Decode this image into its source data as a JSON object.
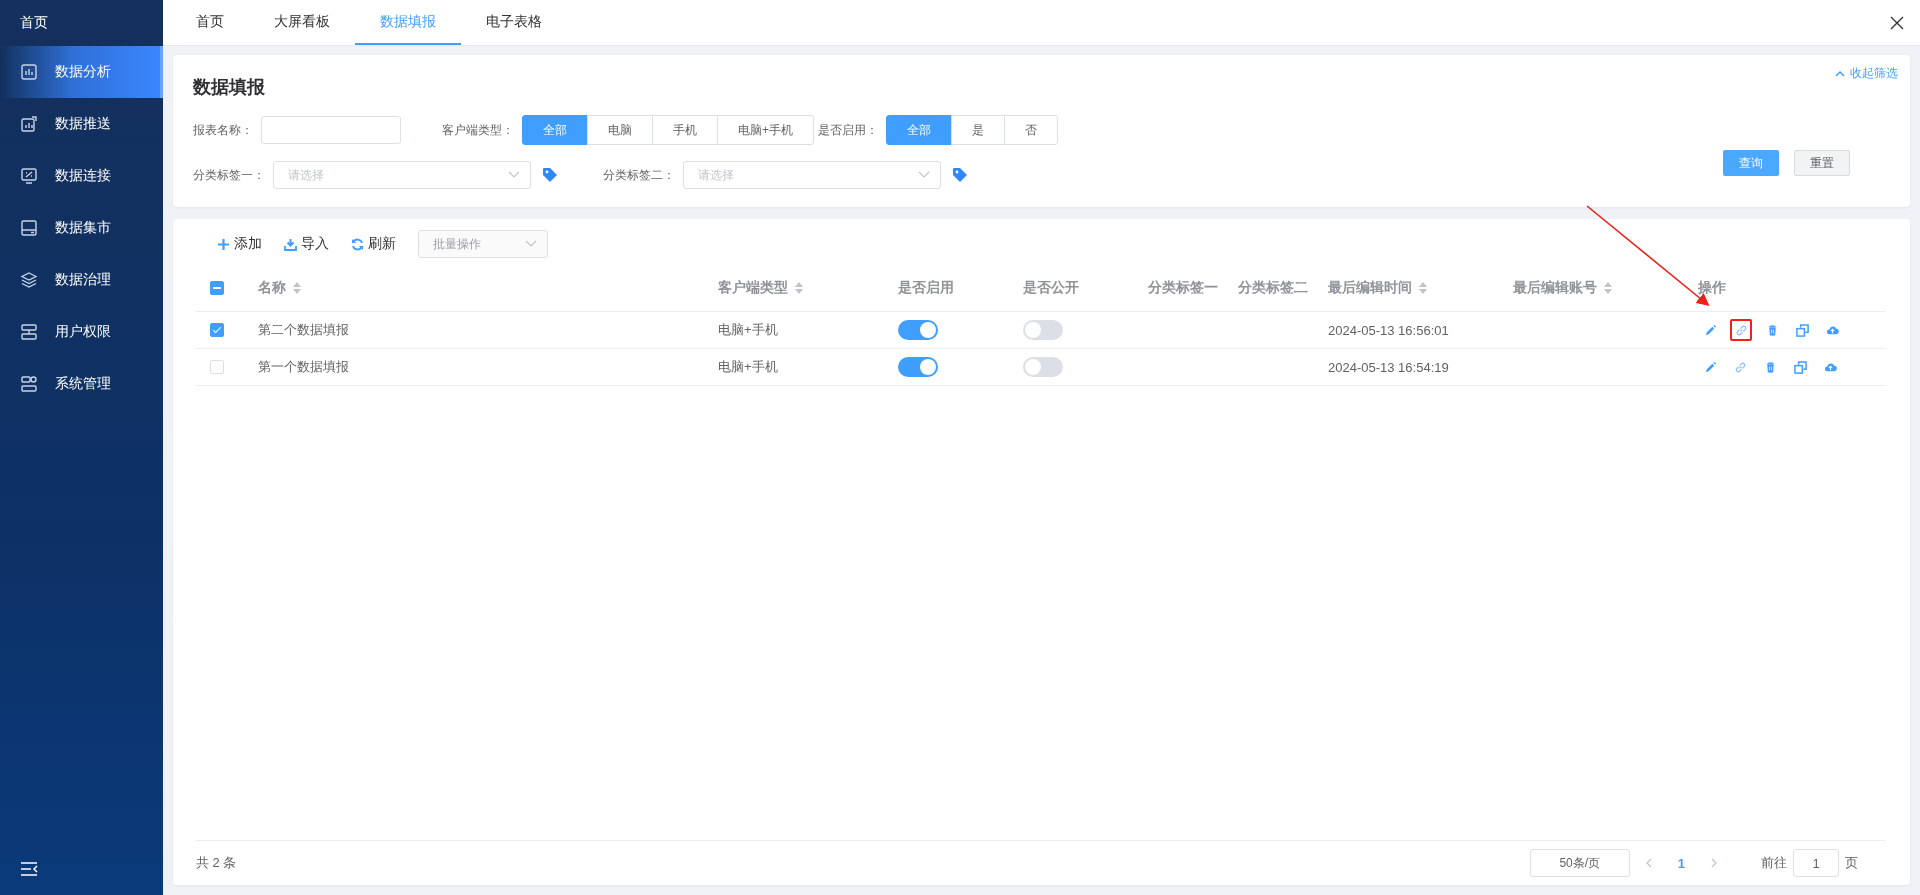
{
  "sidebar": {
    "header": "首页",
    "items": [
      {
        "label": "数据分析",
        "selected": true
      },
      {
        "label": "数据推送",
        "selected": false
      },
      {
        "label": "数据连接",
        "selected": false
      },
      {
        "label": "数据集市",
        "selected": false
      },
      {
        "label": "数据治理",
        "selected": false
      },
      {
        "label": "用户权限",
        "selected": false
      },
      {
        "label": "系统管理",
        "selected": false
      }
    ]
  },
  "tabs": [
    {
      "label": "首页",
      "selected": false
    },
    {
      "label": "大屏看板",
      "selected": false
    },
    {
      "label": "数据填报",
      "selected": true
    },
    {
      "label": "电子表格",
      "selected": false
    }
  ],
  "filter": {
    "title": "数据填报",
    "collapse_link": "收起筛选",
    "report_name": {
      "label": "报表名称："
    },
    "client_type": {
      "label": "客户端类型：",
      "options": [
        {
          "label": "全部",
          "selected": true
        },
        {
          "label": "电脑",
          "selected": false
        },
        {
          "label": "手机",
          "selected": false
        },
        {
          "label": "电脑+手机",
          "selected": false
        }
      ]
    },
    "enabled": {
      "label": "是否启用：",
      "options": [
        {
          "label": "全部",
          "selected": true
        },
        {
          "label": "是",
          "selected": false
        },
        {
          "label": "否",
          "selected": false
        }
      ]
    },
    "tag_one": {
      "label": "分类标签一：",
      "placeholder": "请选择"
    },
    "tag_two": {
      "label": "分类标签二：",
      "placeholder": "请选择"
    },
    "query_button": "查询",
    "reset_button": "重置"
  },
  "toolbar": {
    "add": "添加",
    "import": "导入",
    "refresh": "刷新",
    "batch": {
      "placeholder": "批量操作",
      "disabled": true
    }
  },
  "table": {
    "select_all_partial": true,
    "columns": [
      {
        "label": "名称",
        "sortable": true
      },
      {
        "label": "客户端类型",
        "sortable": true
      },
      {
        "label": "是否启用",
        "sortable": false
      },
      {
        "label": "是否公开",
        "sortable": false
      },
      {
        "label": "分类标签一",
        "sortable": false
      },
      {
        "label": "分类标签二",
        "sortable": false
      },
      {
        "label": "最后编辑时间",
        "sortable": true
      },
      {
        "label": "最后编辑账号",
        "sortable": true
      },
      {
        "label": "操作",
        "sortable": false
      }
    ],
    "rows": [
      {
        "selected": true,
        "name": "第二个数据填报",
        "client_type": "电脑+手机",
        "enabled": true,
        "public": false,
        "time": "2024-05-13 16:56:01",
        "link_highlighted": true
      },
      {
        "selected": false,
        "name": "第一个数据填报",
        "client_type": "电脑+手机",
        "enabled": true,
        "public": false,
        "time": "2024-05-13 16:54:19",
        "link_highlighted": false
      }
    ]
  },
  "pagination": {
    "total": "共 2 条",
    "page_size": "50条/页",
    "pages": [
      {
        "label": "1",
        "selected": true
      }
    ],
    "jump_label": "前往",
    "jump_value": "1",
    "page_unit": "页"
  }
}
